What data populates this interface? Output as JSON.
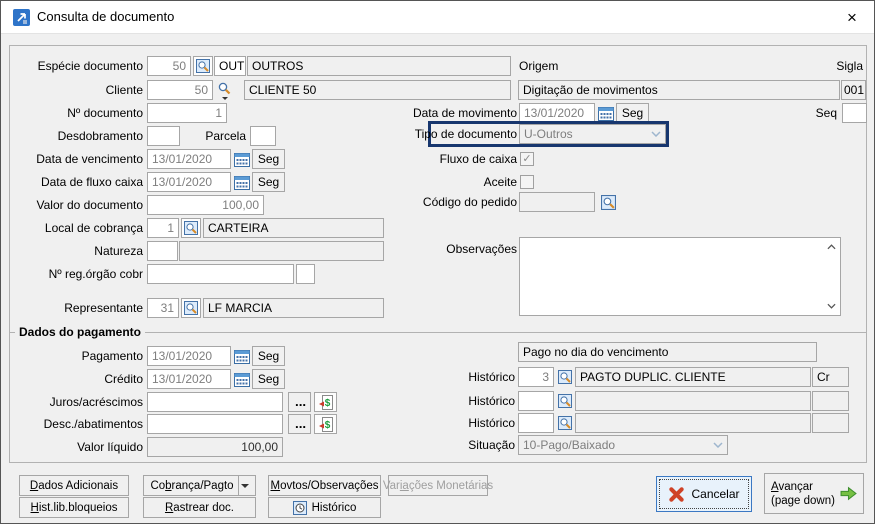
{
  "title_bar": {
    "title": "Consulta de documento",
    "close_glyph": "×"
  },
  "left": {
    "especie": {
      "label": "Espécie documento",
      "code": "50",
      "abbr": "OUT",
      "name": "OUTROS"
    },
    "cliente": {
      "label": "Cliente",
      "code": "50",
      "name": "CLIENTE 50"
    },
    "num_documento": {
      "label": "Nº documento",
      "value": "1"
    },
    "desdobramento": {
      "label": "Desdobramento",
      "value": ""
    },
    "parcela": {
      "label": "Parcela",
      "value": ""
    },
    "data_vencimento": {
      "label": "Data de vencimento",
      "value": "13/01/2020",
      "weekday": "Seg"
    },
    "data_fluxo_caixa": {
      "label": "Data de fluxo caixa",
      "value": "13/01/2020",
      "weekday": "Seg"
    },
    "valor_documento": {
      "label": "Valor do documento",
      "value": "100,00"
    },
    "local_cobranca": {
      "label": "Local de cobrança",
      "code": "1",
      "name": "CARTEIRA"
    },
    "natureza": {
      "label": "Natureza",
      "code": "",
      "name": ""
    },
    "reg_orgao_cobr": {
      "label": "Nº reg.órgão cobr",
      "value": "",
      "extra": ""
    },
    "representante": {
      "label": "Representante",
      "code": "31",
      "name": "LF MARCIA"
    }
  },
  "right": {
    "origem": {
      "label": "Origem",
      "value": "Digitação de movimentos"
    },
    "sigla": {
      "label": "Sigla",
      "value": "001"
    },
    "data_movimento": {
      "label": "Data de movimento",
      "value": "13/01/2020",
      "weekday": "Seg"
    },
    "seq": {
      "label": "Seq",
      "value": ""
    },
    "tipo_documento": {
      "label": "Tipo de documento",
      "value": "U-Outros"
    },
    "fluxo_caixa": {
      "label": "Fluxo de caixa",
      "check_glyph": "✓"
    },
    "aceite": {
      "label": "Aceite",
      "check_glyph": ""
    },
    "codigo_pedido": {
      "label": "Código do pedido",
      "value": ""
    },
    "observacoes": {
      "label": "Observações",
      "value": ""
    }
  },
  "pagamento": {
    "section_title": "Dados do pagamento",
    "pagamento_data": {
      "label": "Pagamento",
      "value": "13/01/2020",
      "weekday": "Seg"
    },
    "credito": {
      "label": "Crédito",
      "value": "13/01/2020",
      "weekday": "Seg"
    },
    "juros": {
      "label": "Juros/acréscimos",
      "value": "",
      "more_label": "..."
    },
    "desc_abatimentos": {
      "label": "Desc./abatimentos",
      "value": "",
      "more_label": "..."
    },
    "valor_liquido": {
      "label": "Valor líquido",
      "value": "100,00"
    },
    "pago_info": "Pago no dia do vencimento",
    "historico1": {
      "label": "Histórico",
      "code": "3",
      "name": "PAGTO DUPLIC. CLIENTE",
      "tag": "Cr"
    },
    "historico2": {
      "label": "Histórico",
      "code": "",
      "name": "",
      "tag": ""
    },
    "historico3": {
      "label": "Histórico",
      "code": "",
      "name": "",
      "tag": ""
    },
    "situacao": {
      "label": "Situação",
      "value": "10-Pago/Baixado"
    }
  },
  "buttons": {
    "dados_adicionais": {
      "pre": "",
      "accel": "D",
      "post": "ados Adicionais"
    },
    "cobranca_pagto": {
      "pre": "Co",
      "accel": "b",
      "post": "rança/Pagto"
    },
    "movtos_observacoes": {
      "pre": "",
      "accel": "M",
      "post": "ovtos/Observações"
    },
    "variacoes_monetarias": {
      "pre": "Var",
      "accel": "ia",
      "post": "ções Monetárias"
    },
    "hist_lib_bloqueios": {
      "pre": "",
      "accel": "H",
      "post": "ist.lib.bloqueios"
    },
    "rastrear_doc": {
      "pre": "",
      "accel": "R",
      "post": "astrear doc."
    },
    "historico": {
      "label": "Histórico"
    },
    "cancelar": {
      "label": "Cancelar"
    },
    "avancar": {
      "pre": "",
      "accel": "A",
      "post": "vançar",
      "line2": "(page down)"
    }
  },
  "colors": {
    "focus_box": "#17366e",
    "cancel_border": "#3b78c3",
    "arrow_green": "#76c043",
    "x_red": "#cf4227"
  }
}
